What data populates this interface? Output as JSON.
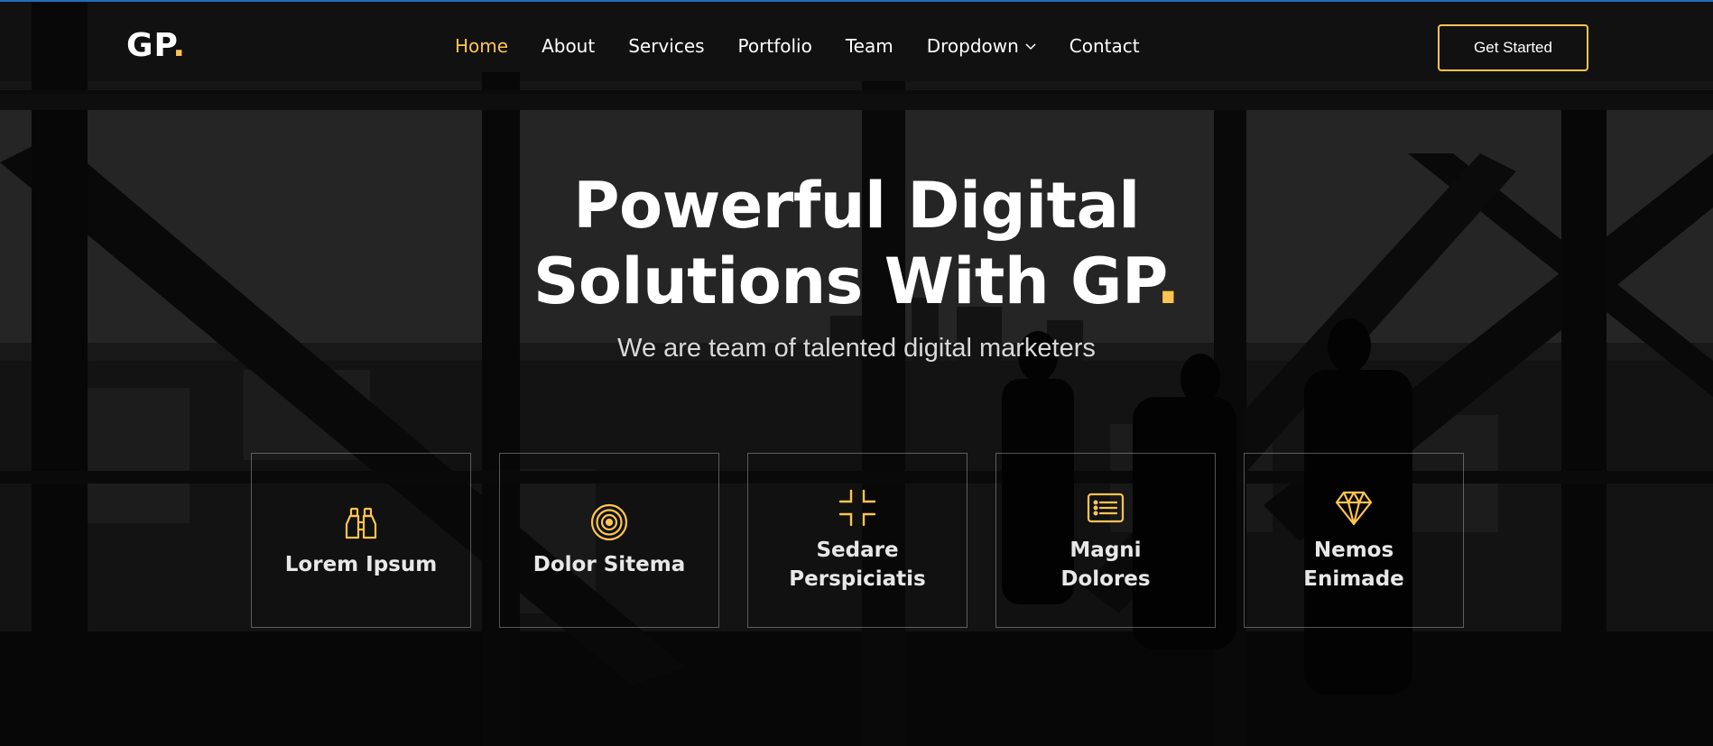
{
  "brand": {
    "name": "GP",
    "dot": ".",
    "accent_color": "#ffc451",
    "topline_color": "#1f6fb8"
  },
  "nav": {
    "items": [
      {
        "label": "Home",
        "active": true
      },
      {
        "label": "About"
      },
      {
        "label": "Services"
      },
      {
        "label": "Portfolio"
      },
      {
        "label": "Team"
      },
      {
        "label": "Dropdown",
        "icon": "chevron-down-icon"
      },
      {
        "label": "Contact"
      }
    ],
    "cta_label": "Get Started"
  },
  "hero": {
    "title_line1": "Powerful Digital",
    "title_line2": "Solutions With GP",
    "title_dot": ".",
    "subtitle": "We are team of talented digital marketers"
  },
  "features": [
    {
      "title": "Lorem Ipsum",
      "icon": "binoculars-icon"
    },
    {
      "title": "Dolor Sitema",
      "icon": "target-icon"
    },
    {
      "title": "Sedare Perspiciatis",
      "icon": "fullscreen-exit-icon"
    },
    {
      "title": "Magni Dolores",
      "icon": "card-list-icon"
    },
    {
      "title": "Nemos Enimade",
      "icon": "gem-icon"
    }
  ]
}
